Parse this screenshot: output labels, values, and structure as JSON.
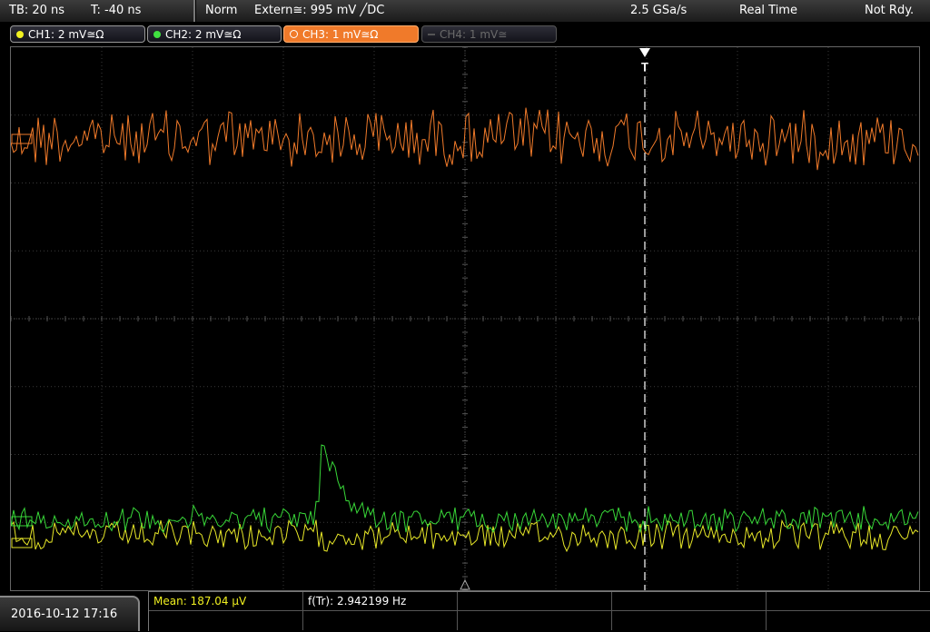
{
  "topbar": {
    "timebase": "TB: 20 ns",
    "time_offset": "T: -40 ns",
    "trigger_mode": "Norm",
    "trigger_source": "Extern≅: 995 mV ╱DC",
    "sample_rate": "2.5 GSa/s",
    "acq_mode": "Real Time",
    "status": "Not Rdy."
  },
  "channels": [
    {
      "label": "CH1: 2 mV≅Ω",
      "color": "#f0f020",
      "state": "on"
    },
    {
      "label": "CH2: 2 mV≅Ω",
      "color": "#40e040",
      "state": "on"
    },
    {
      "label": "CH3: 1 mV≅Ω",
      "color": "#f07a2a",
      "state": "selected"
    },
    {
      "label": "CH4: 1 mV≅",
      "color": "#666666",
      "state": "off"
    }
  ],
  "markers": {
    "trigger": "T"
  },
  "trace_colors": {
    "ch1": "#e8e828",
    "ch2": "#38d838",
    "ch3": "#f07a2a"
  },
  "bottom": {
    "datetime": "2016-10-12 17:16",
    "measurements": [
      {
        "text": "Mean: 187.04 µV",
        "color": "#f0f020"
      },
      {
        "text": "f(Tr): 2.942199 Hz",
        "color": "#ffffff"
      }
    ]
  }
}
